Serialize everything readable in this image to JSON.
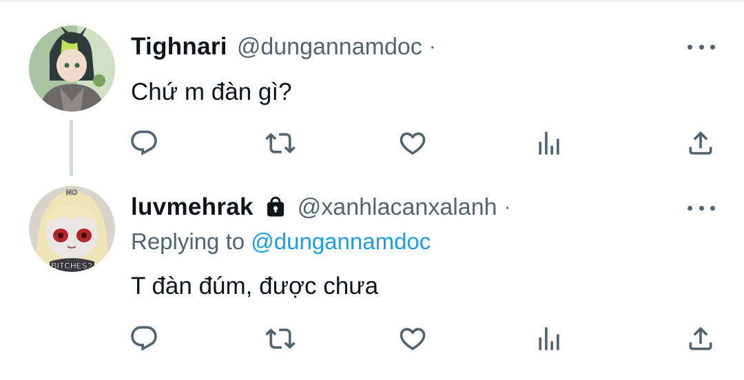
{
  "tweets": [
    {
      "name": "Tighnari",
      "handle": "@dungannamdoc",
      "separator": "·",
      "text": "Chứ m đàn gì?",
      "protected": false,
      "avatar": "tighnari-avatar"
    },
    {
      "name": "luvmehrak",
      "handle": "@xanhlacanxalanh",
      "separator": "·",
      "replying_prefix": "Replying to ",
      "replying_to": "@dungannamdoc",
      "text": "T đàn đúm, được chưa",
      "protected": true,
      "avatar": "plush-avatar",
      "avatar_caption_top": "NO",
      "avatar_caption_bottom": "BITCHES?"
    }
  ],
  "icons": {
    "reply": "reply-icon",
    "retweet": "retweet-icon",
    "like": "heart-icon",
    "views": "views-icon",
    "share": "share-icon",
    "more": "more-icon",
    "lock": "lock-icon"
  },
  "colors": {
    "text": "#0f1419",
    "secondary": "#536471",
    "link": "#1d9bf0",
    "thread_line": "#cfd9de"
  }
}
